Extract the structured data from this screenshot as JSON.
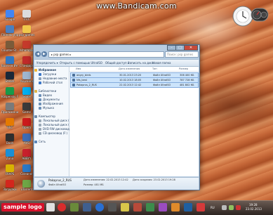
{
  "watermark": "www.Bandicam.com",
  "desktop_icons": [
    {
      "label": "Google",
      "color": "#4285f4"
    },
    {
      "label": "iTVC",
      "color": "#dcdcdc"
    },
    {
      "label": "Панель управл.",
      "color": "#4a7fc0"
    },
    {
      "label": "psp_games",
      "color": "#f1c84b"
    },
    {
      "label": "Counter-St..",
      "color": "#7a5b3a"
    },
    {
      "label": "Ashampoo",
      "color": "#c53a2b"
    },
    {
      "label": "Войти в Интернет",
      "color": "#2f78c4"
    },
    {
      "label": "Стандарт",
      "color": "#c02a2a"
    },
    {
      "label": "Steam",
      "color": "#1b2838"
    },
    {
      "label": "Корзина",
      "color": "#9fb7cf"
    },
    {
      "label": "Kaspersky Free",
      "color": "#179a4a"
    },
    {
      "label": "Skype",
      "color": "#00aff0"
    },
    {
      "label": "Приложение",
      "color": "#7a7a7a"
    },
    {
      "label": "Game",
      "color": "#3a3a3a"
    },
    {
      "label": "VLC",
      "color": "#e57a00"
    },
    {
      "label": "Opera",
      "color": "#cc1b1b"
    },
    {
      "label": "Dash",
      "color": "#2e2e2e"
    },
    {
      "label": "AVS",
      "color": "#3d6bb3"
    },
    {
      "label": "Zona",
      "color": "#1a8fd6"
    },
    {
      "label": "ABBYY",
      "color": "#c8202c"
    },
    {
      "label": "FRAPS",
      "color": "#d8b200"
    },
    {
      "label": "Ccleaner",
      "color": "#2b78c5"
    },
    {
      "label": "Загрузки",
      "color": "#d3261d"
    },
    {
      "label": "uTorrent",
      "color": "#6ea646"
    }
  ],
  "window": {
    "breadcrumb": "▸ psp games ▸",
    "search_placeholder": "Поиск: psp games",
    "toolbar": {
      "organize": "Упорядочить ▾",
      "share": "Открыть с помощью UltraISO",
      "share_menu": "Общий доступ ▾",
      "burn": "Записать на диск",
      "new_folder": "Новая папка"
    },
    "nav_favorites": [
      "Избранное",
      "Загрузки",
      "Недавние места",
      "Рабочий стол"
    ],
    "nav_libraries": [
      "Библиотеки",
      "Видео",
      "Документы",
      "Изображения",
      "Музыка"
    ],
    "nav_computer": [
      "Компьютер",
      "Локальный диск (C:)",
      "Локальный диск (D:)",
      "DVD RW дисковод (E:)",
      "CD-дисковод (F:)"
    ],
    "nav_network": "Сеть",
    "columns": [
      "Имя",
      "Дата изменения",
      "Тип",
      "Размер"
    ],
    "files": [
      {
        "name": "angry_birds",
        "date": "30.01.2013 23:20",
        "type": "Файл UltraISO",
        "size": "306 400 КБ",
        "selected": true
      },
      {
        "name": "Nfs_best",
        "date": "10.02.2013 18:05",
        "type": "Файл UltraISO",
        "size": "787 728 КБ",
        "selected": true
      },
      {
        "name": "Pakaprus_2_RUS",
        "date": "22.02.2013 12:42",
        "type": "Файл UltraISO",
        "size": "481 802 КБ",
        "selected": true
      }
    ],
    "details": {
      "name": "Pakaprus_2_RUS",
      "type": "Файл UltraISO",
      "modified_label": "Дата изменения: 22.02.2013 12:42",
      "size_label": "Размер: 481 МБ",
      "created_label": "Дата создания: 23.02.2013 19:28"
    }
  },
  "taskbar": {
    "logo": "sample logo",
    "lang": "RU",
    "time": "19:28",
    "date": "23.02.2013"
  }
}
